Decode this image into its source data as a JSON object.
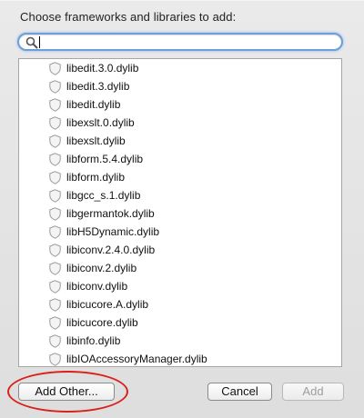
{
  "dialog": {
    "prompt": "Choose frameworks and libraries to add:",
    "search": {
      "value": "",
      "placeholder": ""
    },
    "items": [
      {
        "label": "libedit.3.0.dylib",
        "icon": "library-shield-icon"
      },
      {
        "label": "libedit.3.dylib",
        "icon": "library-shield-icon"
      },
      {
        "label": "libedit.dylib",
        "icon": "library-shield-icon"
      },
      {
        "label": "libexslt.0.dylib",
        "icon": "library-shield-icon"
      },
      {
        "label": "libexslt.dylib",
        "icon": "library-shield-icon"
      },
      {
        "label": "libform.5.4.dylib",
        "icon": "library-shield-icon"
      },
      {
        "label": "libform.dylib",
        "icon": "library-shield-icon"
      },
      {
        "label": "libgcc_s.1.dylib",
        "icon": "library-shield-icon"
      },
      {
        "label": "libgermantok.dylib",
        "icon": "library-shield-icon"
      },
      {
        "label": "libH5Dynamic.dylib",
        "icon": "library-shield-icon"
      },
      {
        "label": "libiconv.2.4.0.dylib",
        "icon": "library-shield-icon"
      },
      {
        "label": "libiconv.2.dylib",
        "icon": "library-shield-icon"
      },
      {
        "label": "libiconv.dylib",
        "icon": "library-shield-icon"
      },
      {
        "label": "libicucore.A.dylib",
        "icon": "library-shield-icon"
      },
      {
        "label": "libicucore.dylib",
        "icon": "library-shield-icon"
      },
      {
        "label": "libinfo.dylib",
        "icon": "library-shield-icon"
      },
      {
        "label": "libIOAccessoryManager.dylib",
        "icon": "library-shield-icon"
      }
    ],
    "buttons": {
      "add_other": "Add Other...",
      "cancel": "Cancel",
      "add": "Add"
    }
  },
  "colors": {
    "annotation_red": "#d9211b",
    "focus_ring": "#6f9ed8",
    "disabled_text": "#9d9d9d"
  }
}
